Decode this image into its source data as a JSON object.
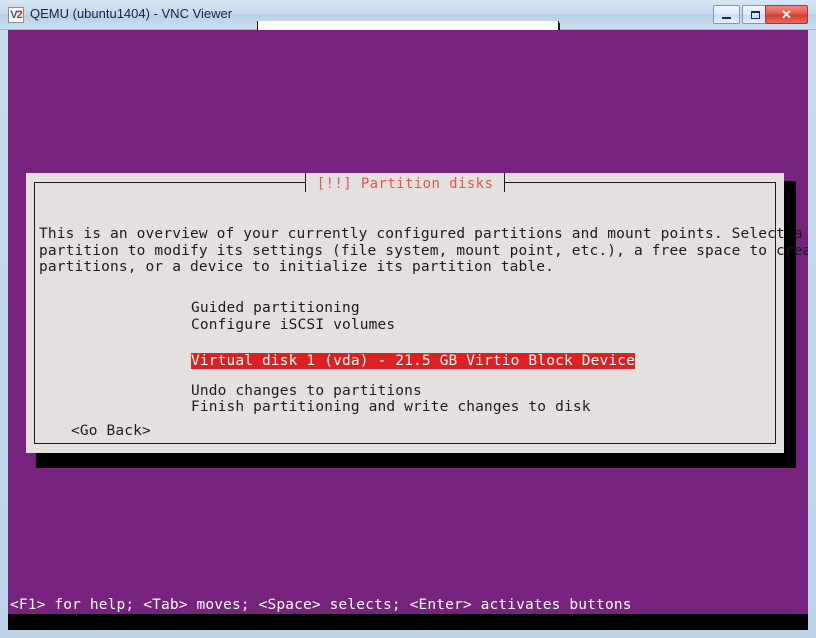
{
  "window": {
    "title": "QEMU (ubuntu1404) - VNC Viewer",
    "app_icon_text": "V2",
    "controls": {
      "minimize": "–",
      "maximize": "□",
      "close": "✕"
    }
  },
  "vnc": {
    "toolbar_tab": ""
  },
  "dialog": {
    "title": "[!!] Partition disks",
    "intro": "This is an overview of your currently configured partitions and mount points. Select a\npartition to modify its settings (file system, mount point, etc.), a free space to create\npartitions, or a device to initialize its partition table.",
    "menu_items": [
      {
        "label": "Guided partitioning",
        "selected": false
      },
      {
        "label": "Configure iSCSI volumes",
        "selected": false
      },
      {
        "label": "",
        "selected": false
      },
      {
        "label": "Virtual disk 1 (vda) - 21.5 GB Virtio Block Device",
        "selected": true
      },
      {
        "label": "",
        "selected": false
      },
      {
        "label": "Undo changes to partitions",
        "selected": false
      },
      {
        "label": "Finish partitioning and write changes to disk",
        "selected": false
      }
    ],
    "go_back_label": "<Go Back>"
  },
  "status_bar": {
    "text": "<F1> for help; <Tab> moves; <Space> selects; <Enter> activates buttons"
  },
  "colors": {
    "console_background": "#76237d",
    "dialog_background": "#e4e0e0",
    "dialog_title": "#e2564f",
    "selection_background": "#dd2020",
    "selection_text": "#ffffff",
    "text": "#1b1b1b"
  }
}
